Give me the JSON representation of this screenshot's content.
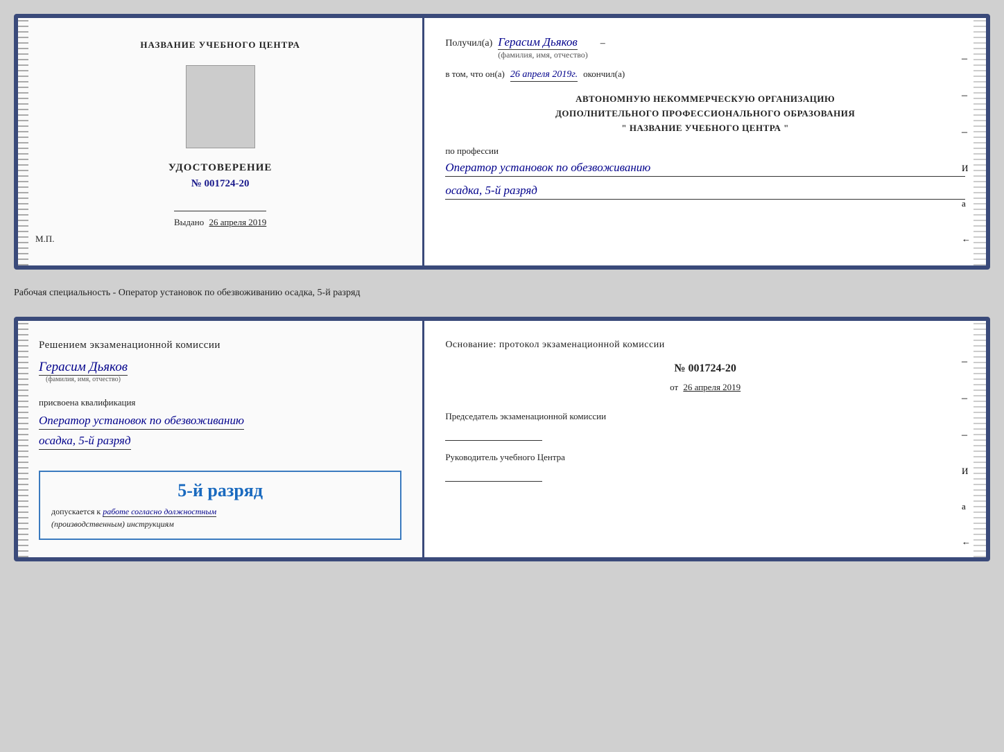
{
  "doc1": {
    "left": {
      "title": "НАЗВАНИЕ УЧЕБНОГО ЦЕНТРА",
      "cert_label": "УДОСТОВЕРЕНИЕ",
      "cert_number": "№ 001724-20",
      "issued_label": "Выдано",
      "issued_date": "26 апреля 2019",
      "mp_label": "М.П."
    },
    "right": {
      "received_prefix": "Получил(а)",
      "recipient_name": "Герасим Дьяков",
      "fio_label": "(фамилия, имя, отчество)",
      "confirmation_prefix": "в том, что он(а)",
      "confirmation_date": "26 апреля 2019г.",
      "confirmation_suffix": "окончил(а)",
      "org_line1": "АВТОНОМНУЮ НЕКОММЕРЧЕСКУЮ ОРГАНИЗАЦИЮ",
      "org_line2": "ДОПОЛНИТЕЛЬНОГО ПРОФЕССИОНАЛЬНОГО ОБРАЗОВАНИЯ",
      "org_line3": "\"   НАЗВАНИЕ УЧЕБНОГО ЦЕНТРА   \"",
      "profession_label": "по профессии",
      "profession_line1": "Оператор установок по обезвоживанию",
      "profession_line2": "осадка, 5-й разряд"
    }
  },
  "specialty_text": "Рабочая специальность - Оператор установок по обезвоживанию осадка, 5-й разряд",
  "doc2": {
    "left": {
      "title": "Решением экзаменационной комиссии",
      "person_name": "Герасим Дьяков",
      "fio_label": "(фамилия, имя, отчество)",
      "qualification_label": "присвоена квалификация",
      "qualification_line1": "Оператор установок по обезвоживанию",
      "qualification_line2": "осадка, 5-й разряд",
      "stamp_rank": "5-й разряд",
      "stamp_prefix": "допускается к",
      "stamp_italic": "работе согласно должностным",
      "stamp_suffix": "(производственным) инструкциям"
    },
    "right": {
      "basis_title": "Основание: протокол экзаменационной комиссии",
      "protocol_number": "№  001724-20",
      "protocol_date_prefix": "от",
      "protocol_date": "26 апреля 2019",
      "chairman_label": "Председатель экзаменационной комиссии",
      "director_label": "Руководитель учебного Центра"
    }
  },
  "dashes": [
    "-",
    "-",
    "-",
    "И",
    "а",
    "←",
    "-",
    "-",
    "-",
    "-"
  ]
}
